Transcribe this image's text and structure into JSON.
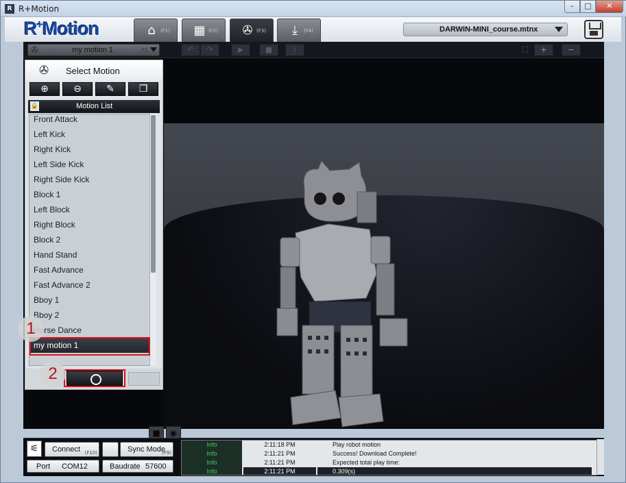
{
  "window": {
    "title": "R+Motion"
  },
  "header": {
    "logo": "R+Motion",
    "tabs": [
      {
        "icon": "home-icon",
        "key": "(F1)"
      },
      {
        "icon": "film-icon",
        "key": "(F2)"
      },
      {
        "icon": "reel-icon",
        "key": "(F3)"
      },
      {
        "icon": "download-icon",
        "key": "(F4)"
      }
    ],
    "active_tab": 2,
    "file_name": "DARWIN-MINI_course.mtnx"
  },
  "motion_bar": {
    "current_motion": "my motion 1",
    "key": "F1"
  },
  "panel": {
    "title": "Select Motion",
    "list_header": "Motion List",
    "items": [
      "Front Attack",
      "Left Kick",
      "Right Kick",
      "Left Side Kick",
      "Right Side Kick",
      "Block 1",
      "Left Block",
      "Right Block",
      "Block 2",
      "Hand Stand",
      "Fast Advance",
      "Fast Advance 2",
      "Bboy 1",
      "Bboy 2",
      "Horse Dance",
      "my motion 1"
    ],
    "selected_index": 15
  },
  "annotations": {
    "badge1": "1",
    "badge2": "2"
  },
  "status": {
    "connect_label": "Connect",
    "connect_key": "(F10)",
    "sync_label": "Sync Mode",
    "sync_key": "(F9)",
    "port_label": "Port",
    "port_value": "COM12",
    "baud_label": "Baudrate",
    "baud_value": "57600",
    "log": [
      {
        "level": "Info",
        "time": "2:11:18 PM",
        "message": "Play robot motion"
      },
      {
        "level": "Info",
        "time": "2:11:21 PM",
        "message": "Success! Download Complete!"
      },
      {
        "level": "Info",
        "time": "2:11:21 PM",
        "message": "Expected total play time:"
      },
      {
        "level": "Info",
        "time": "2:11:21 PM",
        "message": "0.309(s)"
      }
    ]
  },
  "colors": {
    "accent": "#1a4a9c",
    "highlight": "#e0101a",
    "log_level": "#4ec95a"
  }
}
